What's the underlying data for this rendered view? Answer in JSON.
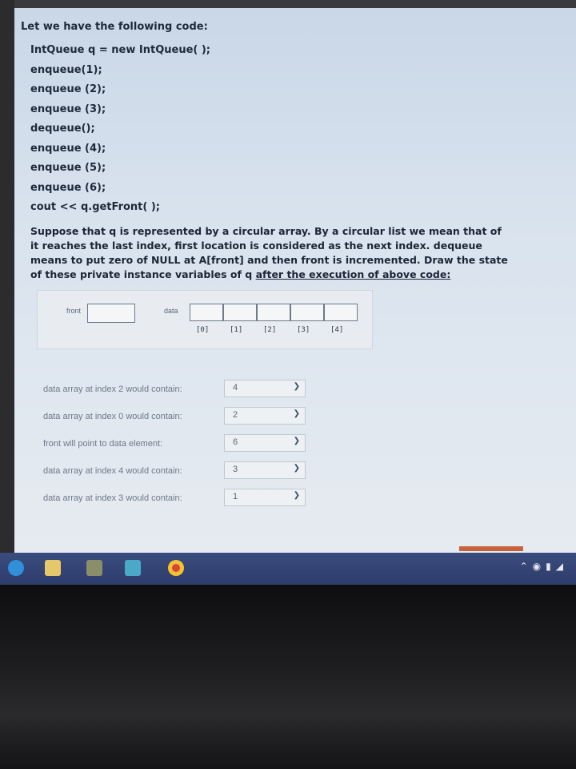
{
  "question": {
    "title": "Let we have the following code:",
    "code": [
      "IntQueue q = new IntQueue( );",
      "enqueue(1);",
      "enqueue (2);",
      "enqueue (3);",
      "dequeue();",
      "enqueue (4);",
      "enqueue (5);",
      "enqueue (6);",
      "cout << q.getFront( );"
    ],
    "description_main": "Suppose that q is represented by a circular array. By a circular list we mean that of it reaches the last index, first location is considered as the next index. dequeue means to put zero of NULL at A[front] and then front is incremented. Draw the state of these private instance variables of q ",
    "description_underlined": "after the execution of above code:"
  },
  "diagram": {
    "front_label": "front",
    "data_label": "data",
    "indices": [
      "[0]",
      "[1]",
      "[2]",
      "[3]",
      "[4]"
    ]
  },
  "answers": [
    {
      "label": "data array at index 2 would contain:",
      "value": "4"
    },
    {
      "label": "data array at index 0 would contain:",
      "value": "2"
    },
    {
      "label": "front will point to data element:",
      "value": "6"
    },
    {
      "label": "data array at index 4 would contain:",
      "value": "3"
    },
    {
      "label": "data array at index 3 would contain:",
      "value": "1"
    }
  ],
  "icons": {
    "dropdown": "chevron-down-icon",
    "taskbar": [
      "edge-icon",
      "file-explorer-icon",
      "store-icon",
      "photos-icon",
      "chrome-icon"
    ],
    "tray": [
      "chevron-up-icon",
      "network-icon",
      "battery-icon",
      "wifi-icon"
    ]
  },
  "colors": {
    "screen_bg": "#d9e3ee",
    "taskbar": "#33447a",
    "accent": "#c8623a"
  }
}
